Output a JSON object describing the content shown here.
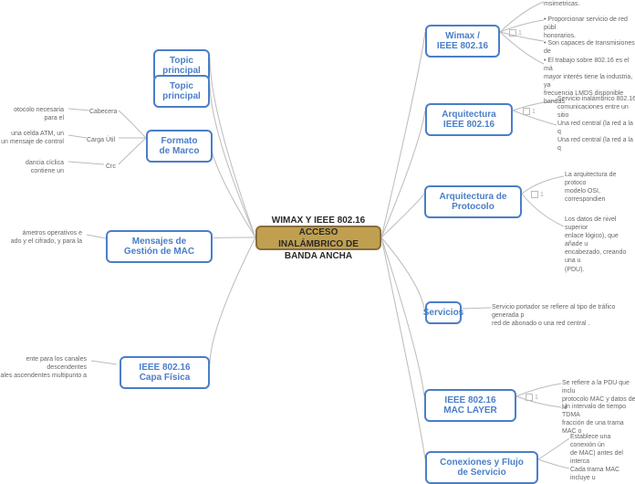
{
  "center": {
    "label": "WIMAX Y IEEE 802.16 ACCESO INALÁMBRICO DE BANDA ANCHA"
  },
  "left": {
    "tp1": "Topic principal",
    "tp2": "Topic principal",
    "formato": "Formato de Marco",
    "mensajes": "Mensajes de Gestión de MAC",
    "fisica": "IEEE 802.16 Capa Física",
    "cabecera": "Cabecera",
    "carga": "Carga Útil",
    "crc": "Crc",
    "f1": "otocolo necesaria para el",
    "f2a": "una celda ATM, un",
    "f2b": "un mensaje de control",
    "f3": "dancia cíclica contiene un",
    "m1a": "ámetros operativos e",
    "m1b": "ado y el cifrado, y para la",
    "p1a": "ente para los canales descendentes",
    "p1b": "ales ascendentes multipunto a"
  },
  "right": {
    "wimax": "Wimax / IEEE 802.16",
    "arq": "Arquitectura IEEE 802.16",
    "proto": "Arquitectura de Protocolo",
    "serv": "Servicios",
    "mac": "IEEE 802.16 MAC LAYER",
    "conex": "Conexiones y Flujo de Servicio",
    "w0": "msimetricas.",
    "w1a": "• Proporcionar servicio de red públ",
    "w1b": "honorarios.",
    "w2": "• Son capaces de transmisiones de",
    "w3a": "• El trabajo sobre 802.16 es el má",
    "w3b": "mayor interés tiene la industria, ya",
    "w3c": "frecuencia LMDS disponible bandas",
    "a1a": "Servicio inalámbrico 802.16",
    "a1b": "comunicaciones entre un sitio",
    "a2a": "Una red central (la red a la q",
    "a2b": "Una red central (la red a la q",
    "pr1a": "La arquitectura de protoco",
    "pr1b": "modelo OSI, correspondien",
    "pr2a": "Los datos de nivel superior",
    "pr2b": "enlace lógico), que añade u",
    "pr2c": "encabezado, creando una u",
    "pr2d": "(PDU).",
    "s1a": "Servicio portador se refiere al tipo de tráfico generada p",
    "s1b": "red de abonado o una red central .",
    "m1a": "Se refiere a la PDU que inclu",
    "m1b": "protocolo MAC y datos de ni",
    "m2a": "Un intervalo de tiempo TDMA",
    "m2b": "fracción de una trama MAC o",
    "c1a": "Establece una conexión ún",
    "c1b": "de MAC) antes del interca",
    "c2": "Cada trama MAC incluye u"
  },
  "badges": {
    "one": "1"
  }
}
